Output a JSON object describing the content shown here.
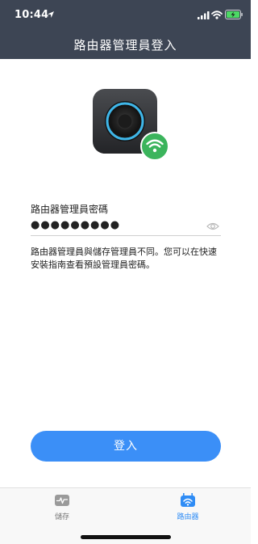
{
  "status_bar": {
    "time": "10:44",
    "icons": [
      "location-arrow-icon",
      "cellular-signal-icon",
      "wifi-icon",
      "battery-charging-icon"
    ]
  },
  "header": {
    "title": "路由器管理員登入",
    "background": "#3d4554"
  },
  "device": {
    "icon": "router-device-icon",
    "badge_icon": "wifi-badge-icon",
    "badge_color": "#3bb45c",
    "ring_color": "#3fb6e8"
  },
  "password": {
    "label": "路由器管理員密碼",
    "value": "●●●●●●●●●",
    "toggle_icon": "eye-icon"
  },
  "info": {
    "text": "路由器管理員與儲存管理員不同。您可以在快速安裝指南查看預設管理員密碼。"
  },
  "login_button": {
    "label": "登入",
    "color": "#3b8ff7"
  },
  "tabbar": {
    "tabs": [
      {
        "label": "儲存",
        "icon": "storage-activity-icon",
        "active": false
      },
      {
        "label": "路由器",
        "icon": "router-tab-icon",
        "active": true
      }
    ],
    "active_color": "#2f8cf5"
  }
}
